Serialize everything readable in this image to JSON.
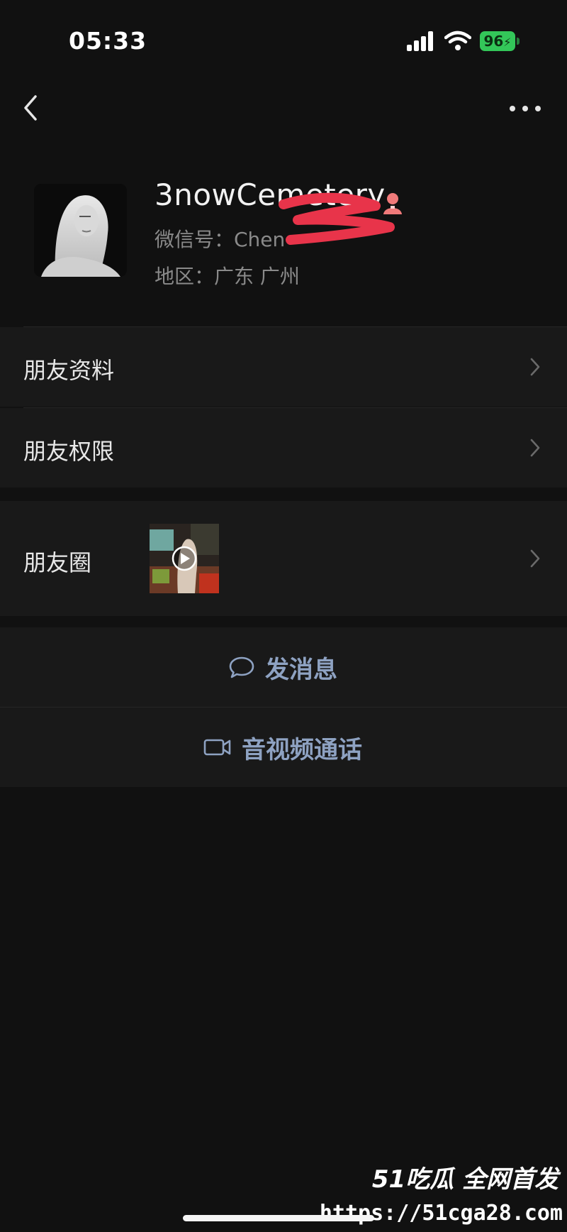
{
  "status_bar": {
    "time": "05:33",
    "battery_level": "96",
    "battery_color": "#33c759"
  },
  "nav": {
    "back_icon": "chevron-left-icon",
    "more_icon": "more-horizontal-icon"
  },
  "profile": {
    "nickname": "3nowCemetery",
    "gender_icon": "female-icon",
    "wechat_id": "微信号：Chen",
    "region": "地区：广东 广州"
  },
  "menu": {
    "friend_profile": "朋友资料",
    "friend_permissions": "朋友权限",
    "moments": "朋友圈"
  },
  "actions": {
    "send_message": "发消息",
    "video_call": "音视频通话",
    "accent_color": "#8ea2c2"
  },
  "watermark": {
    "brand": "51吃瓜 全网首发",
    "url": "https://51cga28.com"
  }
}
